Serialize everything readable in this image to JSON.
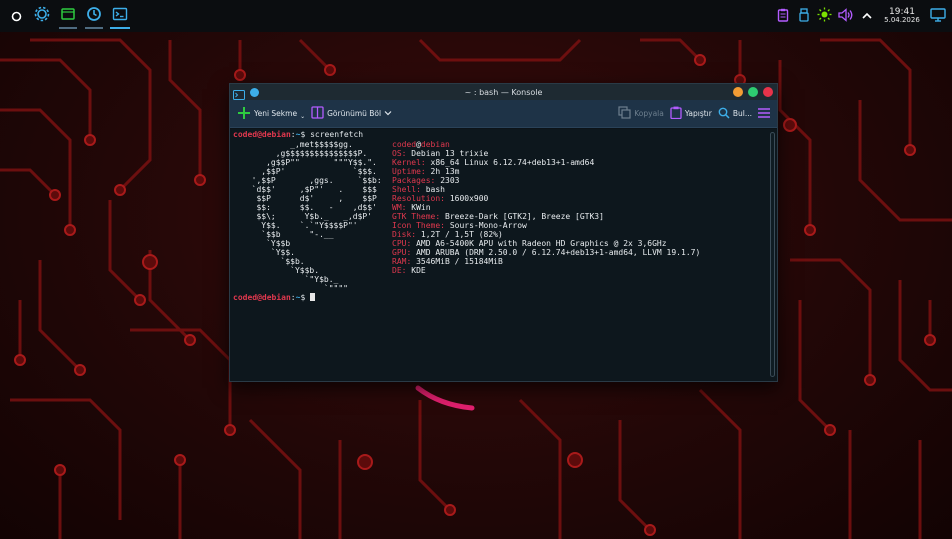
{
  "panel": {
    "launchers": [
      {
        "name": "app-launcher",
        "icon": "circle-icon"
      },
      {
        "name": "settings",
        "icon": "gear-icon"
      },
      {
        "name": "file-manager",
        "icon": "folder-icon"
      },
      {
        "name": "updater",
        "icon": "refresh-icon"
      },
      {
        "name": "konsole",
        "icon": "terminal-icon"
      }
    ],
    "clock": {
      "time": "19:41",
      "date": "5.04.2026"
    },
    "tray": [
      "clipboard-icon",
      "usb-icon",
      "brightness-icon",
      "volume-icon",
      "chevron-up-icon",
      "desktop-icon"
    ],
    "accent": "#3daee9"
  },
  "window": {
    "title": "~ : bash — Konsole",
    "controls": {
      "minimize_color": "#f39c34",
      "maximize_color": "#2ecc71",
      "close_color": "#e8334a"
    }
  },
  "toolbar": {
    "new_tab": "Yeni Sekme",
    "split_view": "Görünümü Böl",
    "copy": "Kopyala",
    "paste": "Yapıştır",
    "find": "Bul..."
  },
  "terminal": {
    "prompt": {
      "user": "coded@debian",
      "sep": ":",
      "path": "~",
      "symbol": "$"
    },
    "command": "screenfetch",
    "logo_lines": [
      "          _,met$$$$$gg.",
      "       ,g$$$$$$$$$$$$$$$P.",
      "     ,g$$P\"\"       \"\"\"Y$$.\".",
      "    ,$$P'              `$$$.",
      "  ',$$P       ,ggs.     `$$b:",
      "  `d$$'     ,$P\"'   .    $$$",
      "   $$P      d$'     ,    $$P",
      "   $$:      $$.   -    ,d$$'",
      "   $$\\;      Y$b._   _,d$P'",
      "    Y$$.    `.`\"Y$$$$P\"'",
      "    `$$b      \"-.__",
      "     `Y$$b",
      "      `Y$$.",
      "        `$$b.",
      "          `Y$$b.",
      "             `\"Y$b._",
      "                 `\"\"\"\""
    ],
    "info_header": {
      "user": "coded",
      "at": "@",
      "host": "debian"
    },
    "info": [
      {
        "key": "OS:",
        "value": "Debian 13 trixie"
      },
      {
        "key": "Kernel:",
        "value": "x86_64 Linux 6.12.74+deb13+1-amd64"
      },
      {
        "key": "Uptime:",
        "value": "2h 13m"
      },
      {
        "key": "Packages:",
        "value": "2303"
      },
      {
        "key": "Shell:",
        "value": "bash"
      },
      {
        "key": "Resolution:",
        "value": "1600x900"
      },
      {
        "key": "WM:",
        "value": "KWin"
      },
      {
        "key": "GTK Theme:",
        "value": "Breeze-Dark [GTK2], Breeze [GTK3]"
      },
      {
        "key": "Icon Theme:",
        "value": "Sours-Mono-Arrow"
      },
      {
        "key": "Disk:",
        "value": "1,2T / 1,5T (82%)"
      },
      {
        "key": "CPU:",
        "value": "AMD A6-5400K APU with Radeon HD Graphics @ 2x 3,6GHz"
      },
      {
        "key": "GPU:",
        "value": "AMD ARUBA (DRM 2.50.0 / 6.12.74+deb13+1-amd64, LLVM 19.1.7)"
      },
      {
        "key": "RAM:",
        "value": "3546MiB / 15184MiB"
      },
      {
        "key": "DE:",
        "value": "KDE"
      }
    ]
  }
}
